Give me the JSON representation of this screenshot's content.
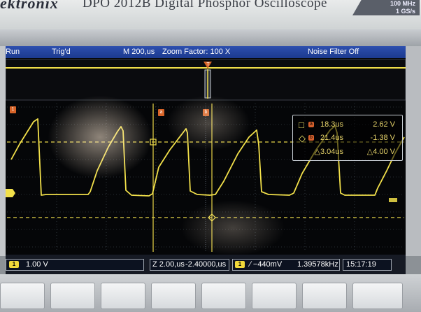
{
  "header": {
    "brand": "ektronix",
    "model": "DPO 2012B Digital Phosphor Oscilloscope",
    "spec_bandwidth": "100 MHz",
    "spec_sample_rate": "1 GS/s"
  },
  "status_bar": {
    "run_state": "Run",
    "trigger_state": "Trig'd",
    "timebase": "M 200,us",
    "zoom": "Zoom Factor: 100 X",
    "noise_filter": "Noise Filter Off"
  },
  "markers": {
    "cursor_a": "a",
    "cursor_b": "b",
    "channel_1": "1",
    "trigger_level": "T",
    "channel_ref": "1"
  },
  "measurements": {
    "cursor_a_time": "18.3us",
    "cursor_a_volt": "2.62 V",
    "cursor_b_time": "21.4us",
    "cursor_b_volt": "-1.38 V",
    "delta_time": "△3.04us",
    "delta_volt": "△4.00 V"
  },
  "bottom_bar": {
    "ch1_badge": "1",
    "ch1_scale": "1.00 V",
    "zoom_scale": "Z 2.00,us",
    "zoom_position": "-2.40000,us",
    "trigger_badge": "1",
    "trigger_level": "∕ −440mV",
    "frequency": "1.39578kHz",
    "time": "15:17:19"
  },
  "colors": {
    "trace": "#f2e04a",
    "status_bar": "#2446a3",
    "cursor_marker": "#d86428"
  },
  "icons": {
    "cursor_a_symbol": "square-icon",
    "cursor_b_symbol": "diamond-icon"
  }
}
